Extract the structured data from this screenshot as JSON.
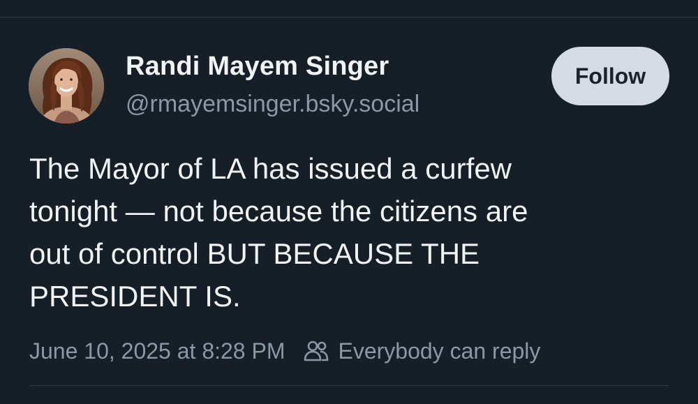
{
  "post": {
    "author": {
      "display_name": "Randi Mayem Singer",
      "handle": "@rmayemsinger.bsky.social",
      "avatar_icon": "profile-photo"
    },
    "follow_label": "Follow",
    "text_lines": [
      "The Mayor of LA has issued a curfew",
      "tonight — not because the citizens are",
      "out of control BUT BECAUSE THE",
      "PRESIDENT IS."
    ],
    "timestamp": "June 10, 2025 at 8:28 PM",
    "reply_setting": {
      "icon": "people-icon",
      "label": "Everybody can reply"
    }
  },
  "colors": {
    "background": "#161e27",
    "primary_text": "#f1f3f5",
    "secondary_text": "#8b98a5",
    "follow_button_bg": "#d4dbe2",
    "divider": "#2b3947"
  }
}
